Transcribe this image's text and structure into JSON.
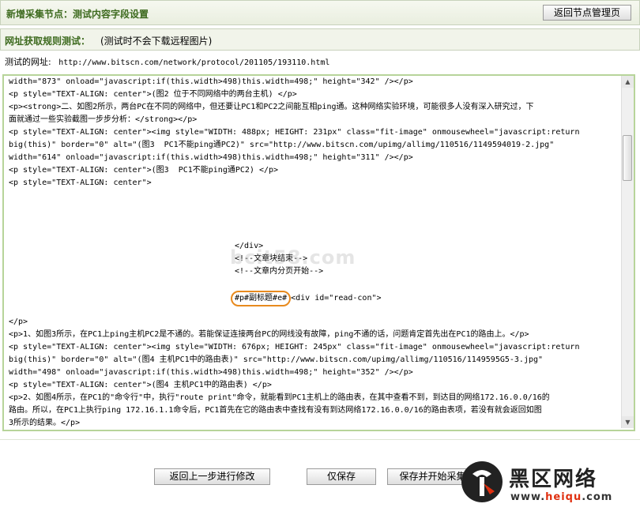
{
  "header": {
    "title": "新增采集节点：测试内容字段设置",
    "back_button": "返回节点管理页"
  },
  "section": {
    "label": "网址获取规则测试：",
    "note": "(测试时不会下载远程图片)"
  },
  "test_url": {
    "label": "测试的网址:",
    "value": "http://www.bitscn.com/network/protocol/201105/193110.html"
  },
  "editor": {
    "lines_top": [
      "width=\"873\" onload=\"javascript:if(this.width>498)this.width=498;\" height=\"342\" /></p>",
      "<p style=\"TEXT-ALIGN: center\">(图2 位于不同网络中的两台主机) </p>",
      "<p><strong>二、如图2所示，两台PC在不同的网络中，但还要让PC1和PC2之间能互相ping通。这种网络实验环境，可能很多人没有深入研究过，下",
      "面就通过一些实验截图一步步分析：</strong></p>",
      "<p style=\"TEXT-ALIGN: center\"><img style=\"WIDTH: 488px; HEIGHT: 231px\" class=\"fit-image\" onmousewheel=\"javascript:return",
      "big(this)\" border=\"0\" alt=\"(图3  PC1不能ping通PC2)\" src=\"http://www.bitscn.com/upimg/allimg/110516/1149594019-2.jpg\"",
      "width=\"614\" onload=\"javascript:if(this.width>498)this.width=498;\" height=\"311\" /></p>",
      "<p style=\"TEXT-ALIGN: center\">(图3  PC1不能ping通PC2) </p>",
      "<p style=\"TEXT-ALIGN: center\">"
    ],
    "lines_mid": [
      "</div>",
      "<!--文章块结束-->",
      "<!--文章内分页开始-->"
    ],
    "highlight_token": "#p#副标题#e#",
    "highlight_rest": "<div id=\"read-con\">",
    "lines_bottom": [
      "</p>",
      "<p>1、如图3所示，在PC1上ping主机PC2是不通的。若能保证连接两台PC的网线没有故障，ping不通的话，问题肯定首先出在PC1的路由上。</p>",
      "<p style=\"TEXT-ALIGN: center\"><img style=\"WIDTH: 676px; HEIGHT: 245px\" class=\"fit-image\" onmousewheel=\"javascript:return",
      "big(this)\" border=\"0\" alt=\"(图4 主机PC1中的路由表)\" src=\"http://www.bitscn.com/upimg/allimg/110516/1149595G5-3.jpg\"",
      "width=\"498\" onload=\"javascript:if(this.width>498)this.width=498;\" height=\"352\" /></p>",
      "<p style=\"TEXT-ALIGN: center\">(图4 主机PC1中的路由表) </p>",
      "<p>2、如图4所示，在PC1的\"命令行\"中，执行\"route print\"命令，就能看到PC1主机上的路由表，在其中查看不到，到达目的网络172.16.0.0/16的",
      "路由。所以，在PC1上执行ping 172.16.1.1命令后，PC1首先在它的路由表中查找有没有到达网络172.16.0.0/16的路由表项，若没有就会返回如图",
      "3所示的结果。</p>"
    ],
    "watermark": "bcit58.com"
  },
  "actions": {
    "back": "返回上一步进行修改",
    "save": "仅保存",
    "save_and_start": "保存并开始采集"
  },
  "brand": {
    "name": "黑区网络",
    "site_prefix": "www.",
    "site_domain": "heiqu",
    "site_suffix": ".com"
  }
}
